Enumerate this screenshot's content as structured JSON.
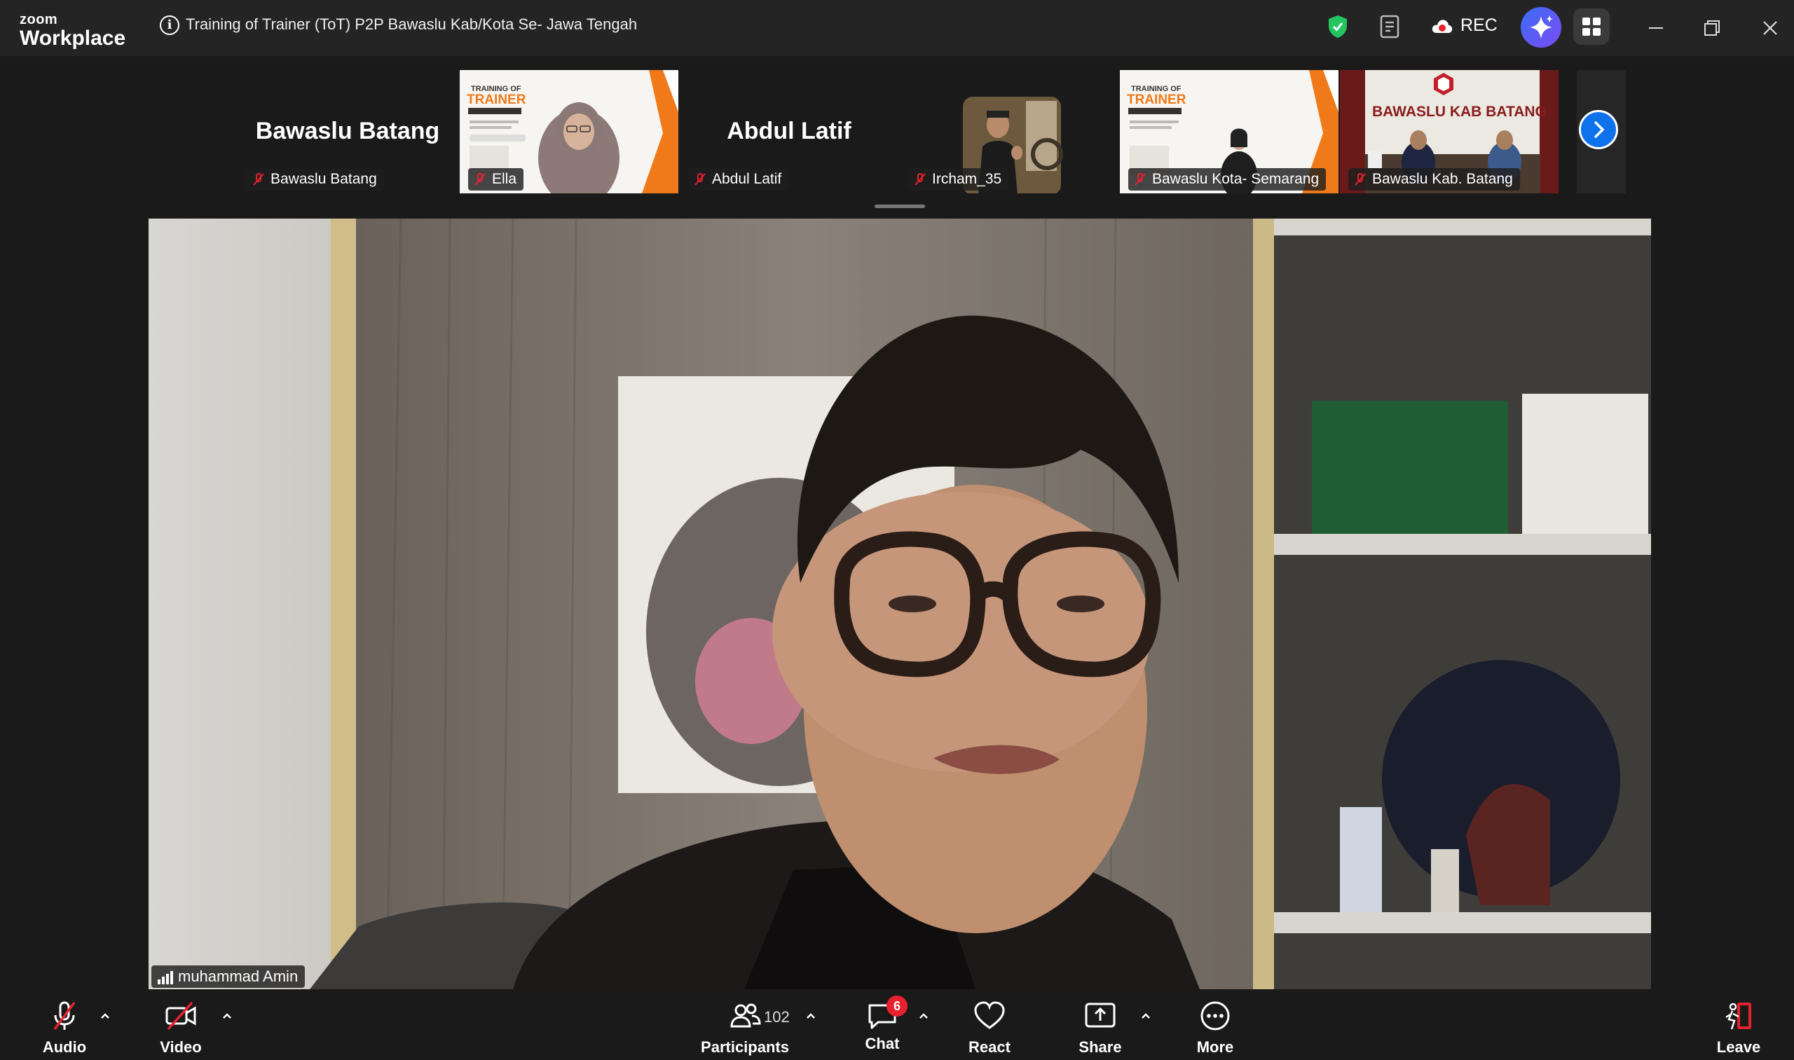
{
  "app": {
    "logo_small": "zoom",
    "logo_big": "Workplace"
  },
  "meeting": {
    "title": "Training of Trainer (ToT) P2P Bawaslu Kab/Kota Se- Jawa Tengah"
  },
  "titlebar": {
    "rec_label": "REC"
  },
  "participants_strip": [
    {
      "name": "Bawaslu Batang",
      "big_name": "Bawaslu Batang",
      "video": false
    },
    {
      "name": "Ella",
      "video": true
    },
    {
      "name": "Abdul Latif",
      "big_name": "Abdul Latif",
      "video": false
    },
    {
      "name": "Ircham_35",
      "video": true
    },
    {
      "name": "Bawaslu Kota- Semarang",
      "video": true
    },
    {
      "name": "Bawaslu Kab. Batang",
      "video": true,
      "banner_text": "BAWASLU KAB BATANG"
    }
  ],
  "slide_thumb": {
    "line1": "TRAINING OF",
    "line2": "TRAINER",
    "line3": "BAWASLU JATENG"
  },
  "main_speaker": {
    "name": "muhammad Amin"
  },
  "toolbar": {
    "audio": "Audio",
    "video": "Video",
    "participants": "Participants",
    "participants_count": "102",
    "chat": "Chat",
    "chat_badge": "6",
    "react": "React",
    "share": "Share",
    "more": "More",
    "leave": "Leave"
  },
  "colors": {
    "accent_blue": "#0e72ed",
    "leave_red": "#e8212e",
    "shield_green": "#22c55e",
    "slide_orange": "#f07a1a"
  }
}
